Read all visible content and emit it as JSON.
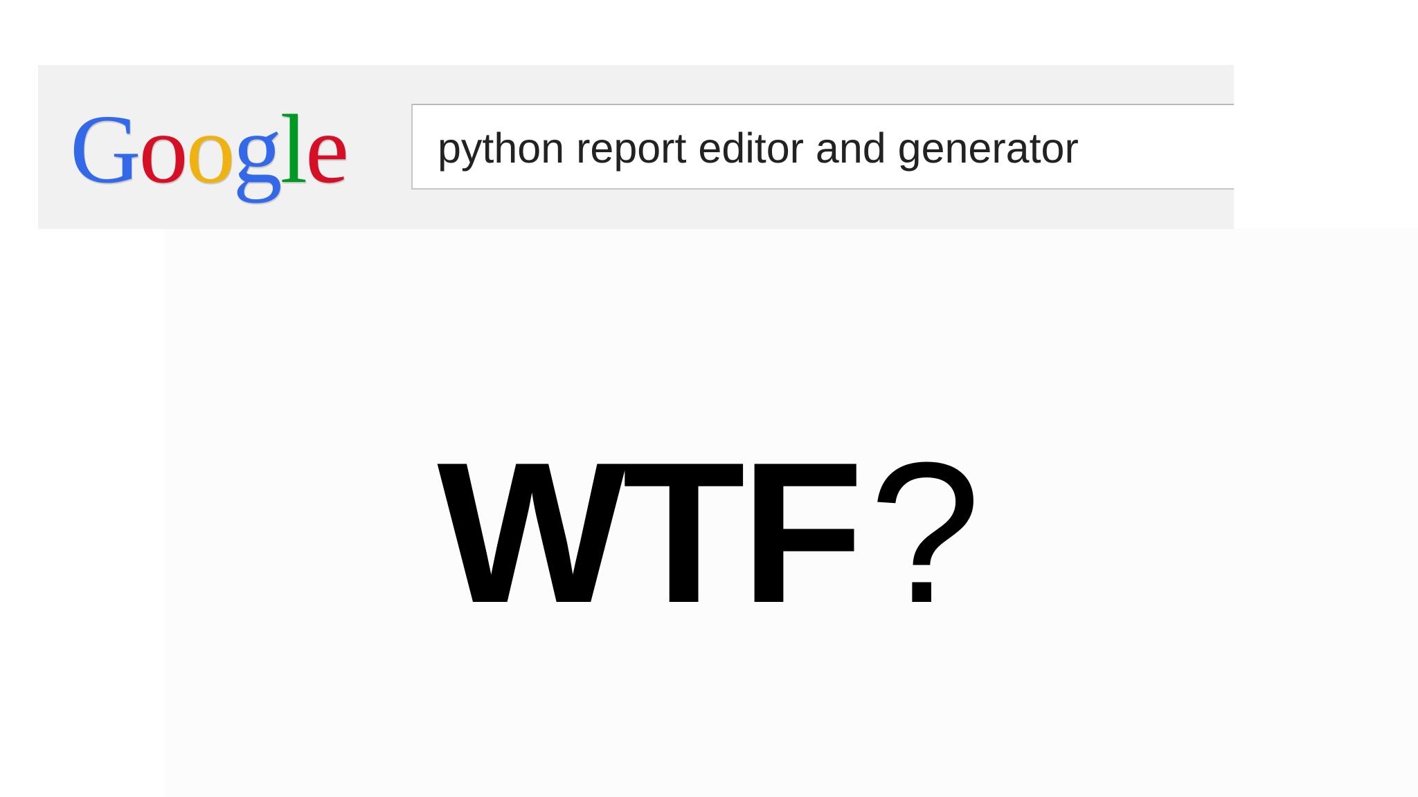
{
  "search": {
    "logo_letters": [
      "G",
      "o",
      "o",
      "g",
      "l",
      "e"
    ],
    "logo_colors": [
      "#3369e8",
      "#d50f25",
      "#eeb211",
      "#3369e8",
      "#009925",
      "#d50f25"
    ],
    "query": "python report editor and generator"
  },
  "headline": {
    "bold_text": "WTF",
    "punctuation": "?"
  }
}
